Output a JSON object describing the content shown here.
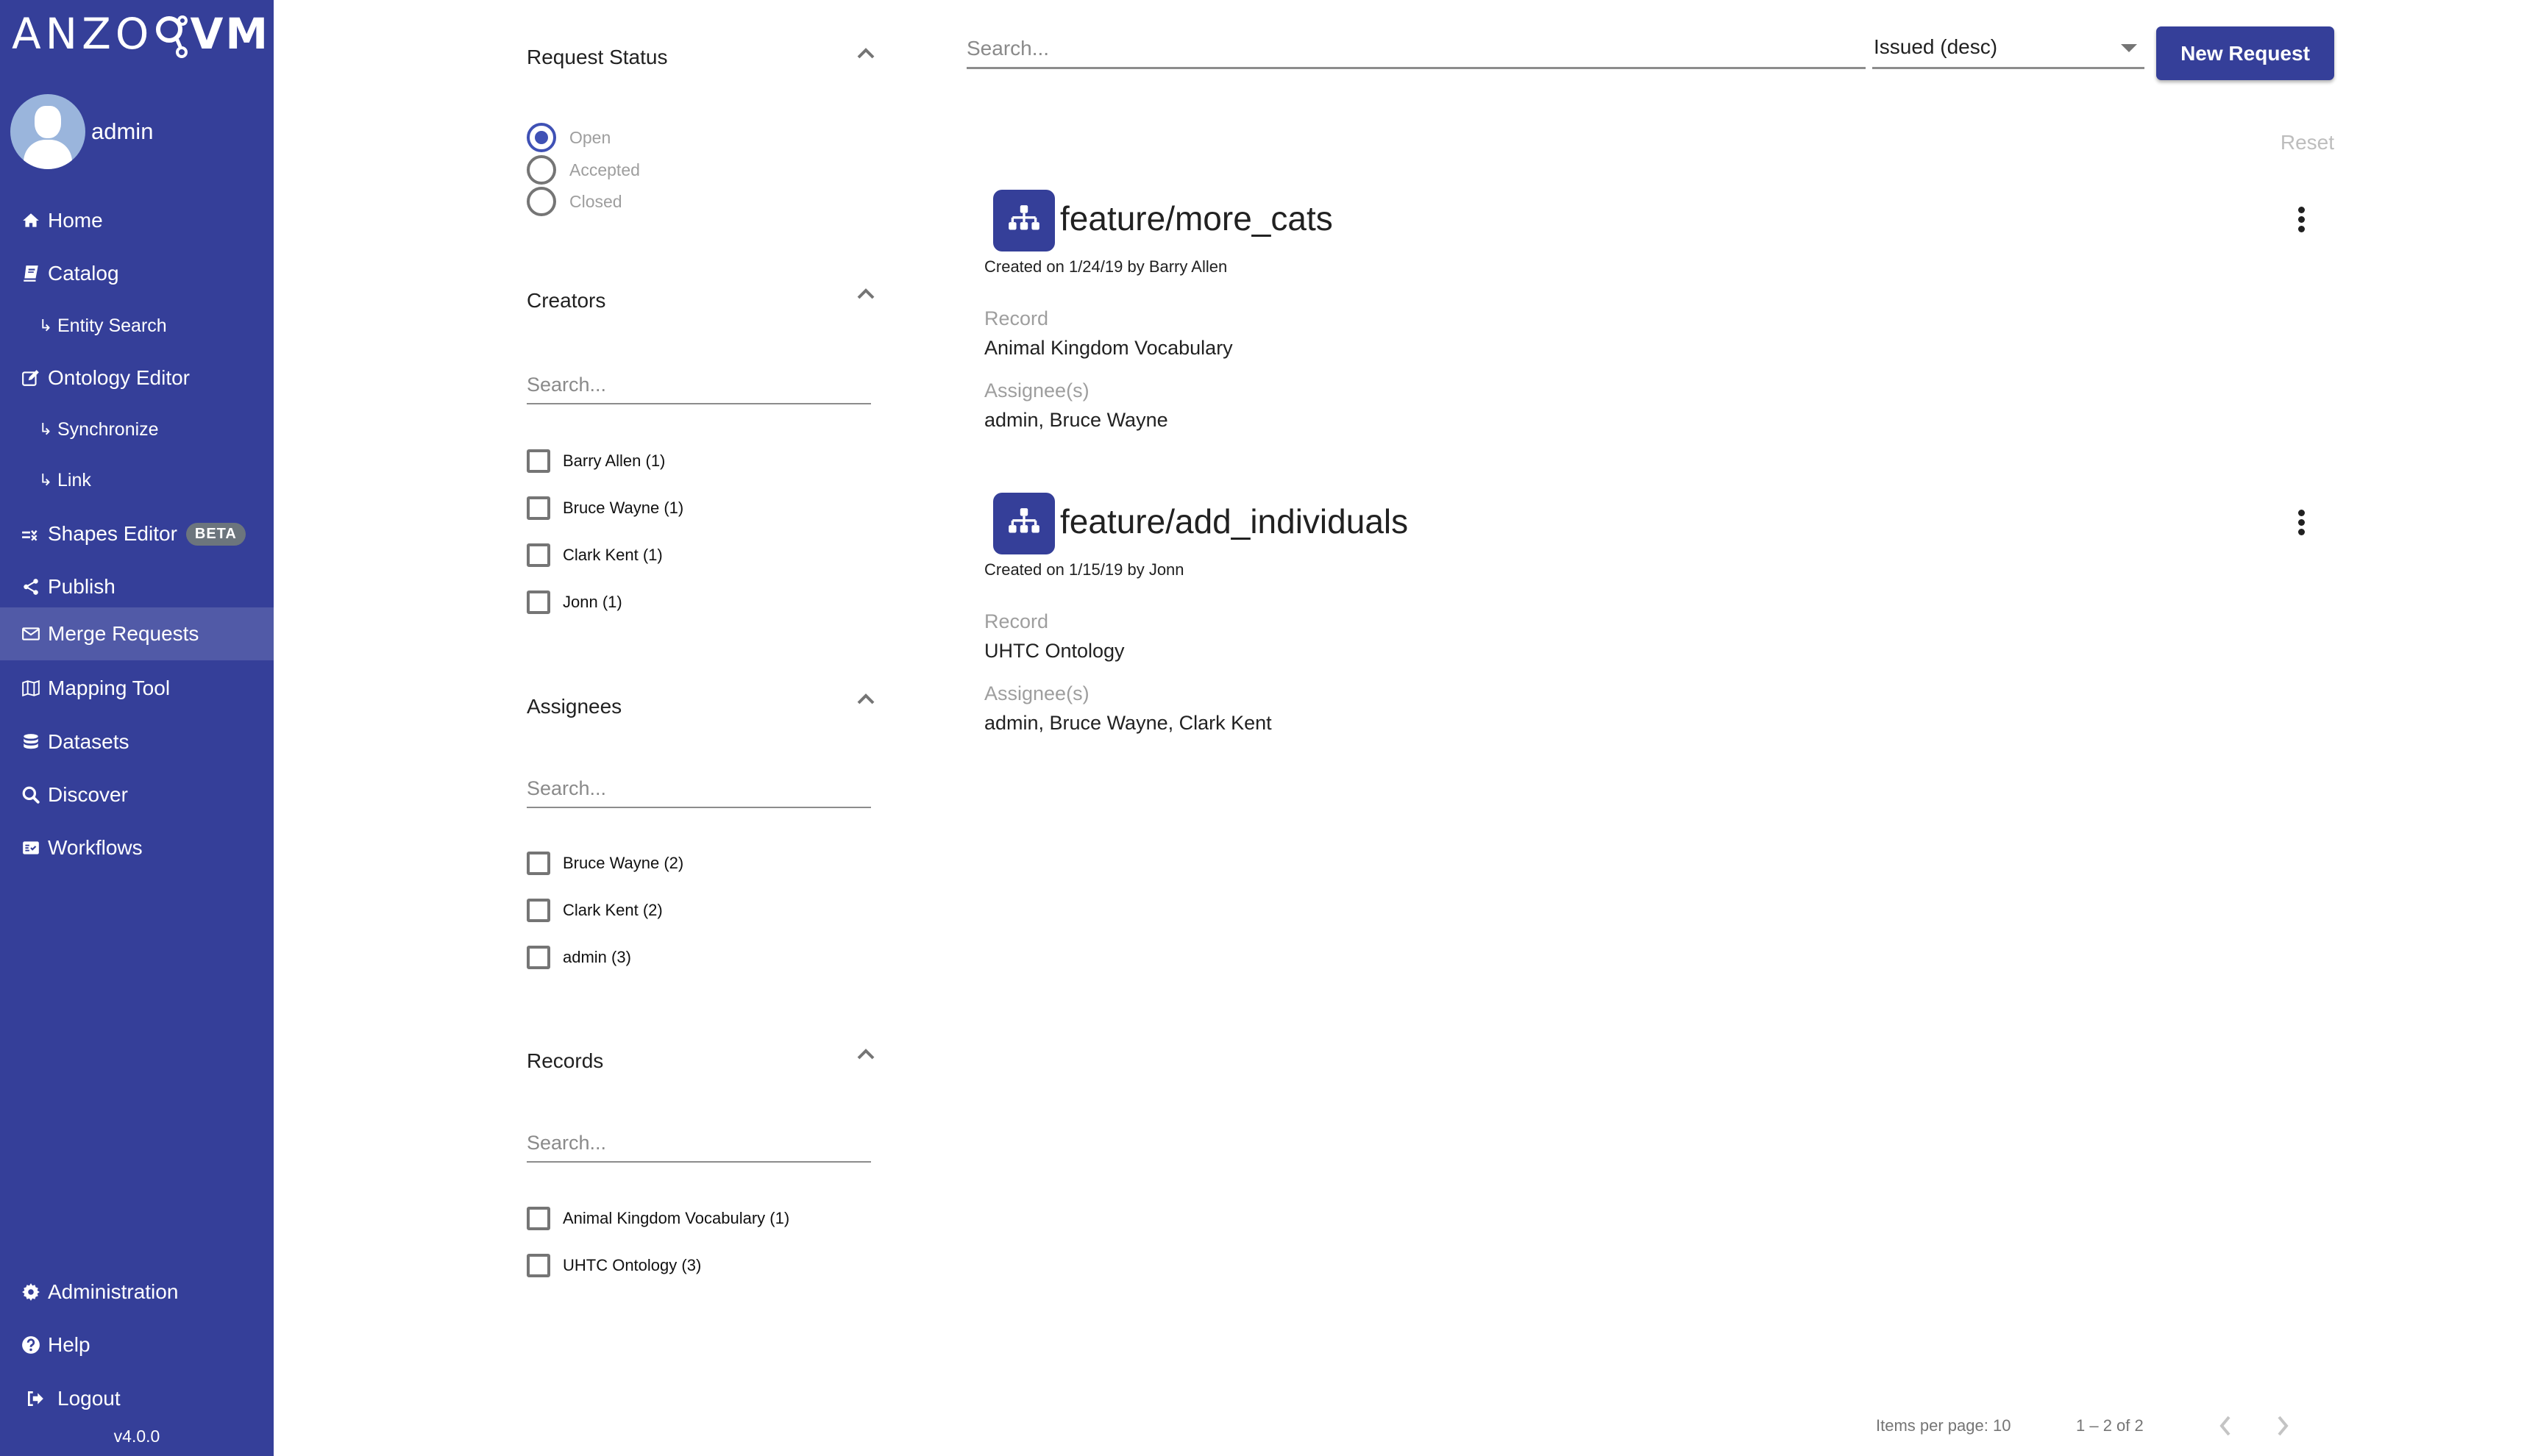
{
  "app": {
    "logo": {
      "left": "ANZO",
      "right": "VM"
    },
    "user": {
      "name": "admin"
    },
    "version": "v4.0.0",
    "colors": {
      "brand": "#353f99",
      "active_nav": "#515aa7",
      "accent": "#3f51b5"
    }
  },
  "sidebar": {
    "items": [
      {
        "label": "Home",
        "icon": "home-icon"
      },
      {
        "label": "Catalog",
        "icon": "book-icon"
      },
      {
        "label": "Entity Search",
        "icon": "subitem-arrow-icon",
        "sub": true
      },
      {
        "label": "Ontology Editor",
        "icon": "edit-icon"
      },
      {
        "label": "Synchronize",
        "icon": "subitem-arrow-icon",
        "sub": true
      },
      {
        "label": "Link",
        "icon": "subitem-arrow-icon",
        "sub": true
      },
      {
        "label": "Shapes Editor",
        "icon": "shapes-icon",
        "badge": "BETA"
      },
      {
        "label": "Publish",
        "icon": "share-icon"
      },
      {
        "label": "Merge Requests",
        "icon": "envelope-icon",
        "active": true
      },
      {
        "label": "Mapping Tool",
        "icon": "map-icon"
      },
      {
        "label": "Datasets",
        "icon": "database-icon"
      },
      {
        "label": "Discover",
        "icon": "search-icon"
      },
      {
        "label": "Workflows",
        "icon": "workflow-icon"
      }
    ],
    "bottom": [
      {
        "label": "Administration",
        "icon": "gear-icon"
      },
      {
        "label": "Help",
        "icon": "help-icon"
      },
      {
        "label": "Logout",
        "icon": "logout-icon"
      }
    ]
  },
  "filters": {
    "request_status": {
      "title": "Request Status",
      "options": [
        {
          "label": "Open",
          "selected": true
        },
        {
          "label": "Accepted",
          "selected": false
        },
        {
          "label": "Closed",
          "selected": false
        }
      ]
    },
    "creators": {
      "title": "Creators",
      "search_placeholder": "Search...",
      "options": [
        {
          "label": "Barry Allen (1)",
          "checked": false
        },
        {
          "label": "Bruce Wayne (1)",
          "checked": false
        },
        {
          "label": "Clark Kent (1)",
          "checked": false
        },
        {
          "label": "Jonn (1)",
          "checked": false
        }
      ]
    },
    "assignees": {
      "title": "Assignees",
      "search_placeholder": "Search...",
      "options": [
        {
          "label": "Bruce Wayne (2)",
          "checked": false
        },
        {
          "label": "Clark Kent (2)",
          "checked": false
        },
        {
          "label": "admin (3)",
          "checked": false
        }
      ]
    },
    "records": {
      "title": "Records",
      "search_placeholder": "Search...",
      "options": [
        {
          "label": "Animal Kingdom Vocabulary (1)",
          "checked": false
        },
        {
          "label": "UHTC Ontology (3)",
          "checked": false
        }
      ]
    }
  },
  "toolbar": {
    "search_placeholder": "Search...",
    "search_value": "",
    "sort_value": "Issued (desc)",
    "new_request_label": "New Request",
    "reset_label": "Reset"
  },
  "requests": [
    {
      "title": "feature/more_cats",
      "created": "Created on 1/24/19 by Barry Allen",
      "record_label": "Record",
      "record": "Animal Kingdom Vocabulary",
      "assignees_label": "Assignee(s)",
      "assignees": "admin, Bruce Wayne"
    },
    {
      "title": "feature/add_individuals",
      "created": "Created on 1/15/19 by Jonn",
      "record_label": "Record",
      "record": "UHTC Ontology",
      "assignees_label": "Assignee(s)",
      "assignees": "admin, Bruce Wayne, Clark Kent"
    }
  ],
  "pagination": {
    "items_per_page": "Items per page: 10",
    "range": "1 – 2 of 2"
  }
}
